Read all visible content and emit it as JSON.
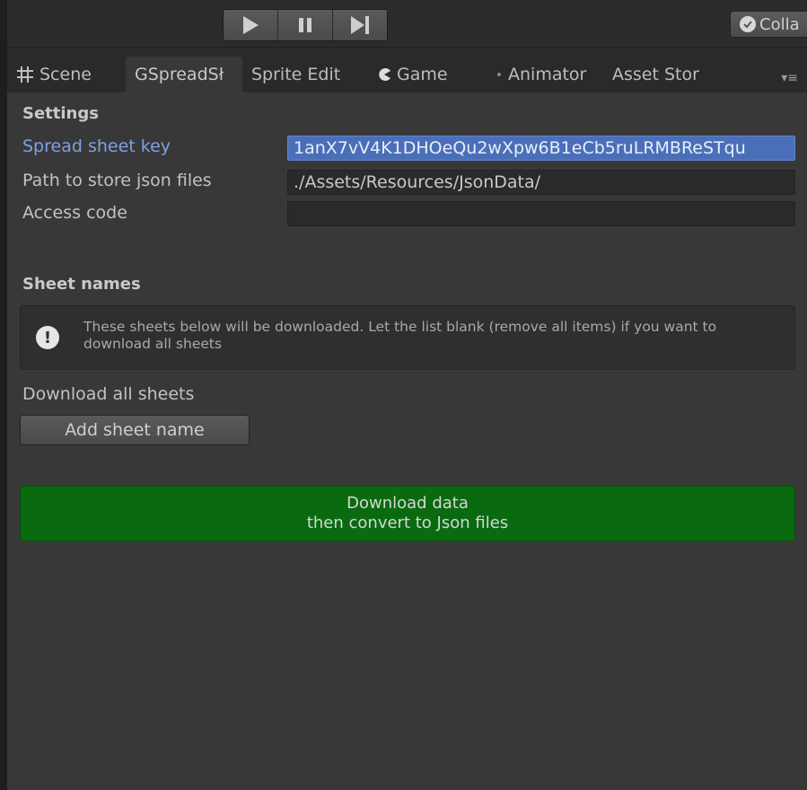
{
  "toolbar": {
    "play_icon": "play-icon",
    "pause_icon": "pause-icon",
    "step_icon": "step-icon",
    "collapse_label": "Colla"
  },
  "tabs": [
    {
      "label": "Scene",
      "icon": "grid-icon"
    },
    {
      "label": "GSpreadSł",
      "active": true
    },
    {
      "label": "Sprite Edit"
    },
    {
      "label": "Game",
      "icon": "pacman-icon"
    },
    {
      "label": "Animator",
      "icon": "dot-icon"
    },
    {
      "label": "Asset Stor"
    }
  ],
  "settings": {
    "title": "Settings",
    "spreadsheet_key_label": "Spread sheet key",
    "spreadsheet_key_value": "1anX7vV4K1DHOeQu2wXpw6B1eCb5ruLRMBReSTqu",
    "path_label": "Path to store json files",
    "path_value": "./Assets/Resources/JsonData/",
    "access_code_label": "Access code",
    "access_code_value": ""
  },
  "sheets": {
    "title": "Sheet names",
    "help_text": "These sheets below will be downloaded. Let the list blank (remove all items) if you want to download all sheets",
    "download_all_label": "Download all sheets",
    "add_button_label": "Add sheet name"
  },
  "download": {
    "line1": "Download data",
    "line2": "then convert to Json files"
  },
  "colors": {
    "background": "#383838",
    "selection": "#4a6fb8",
    "download_button": "#0a6a10"
  }
}
